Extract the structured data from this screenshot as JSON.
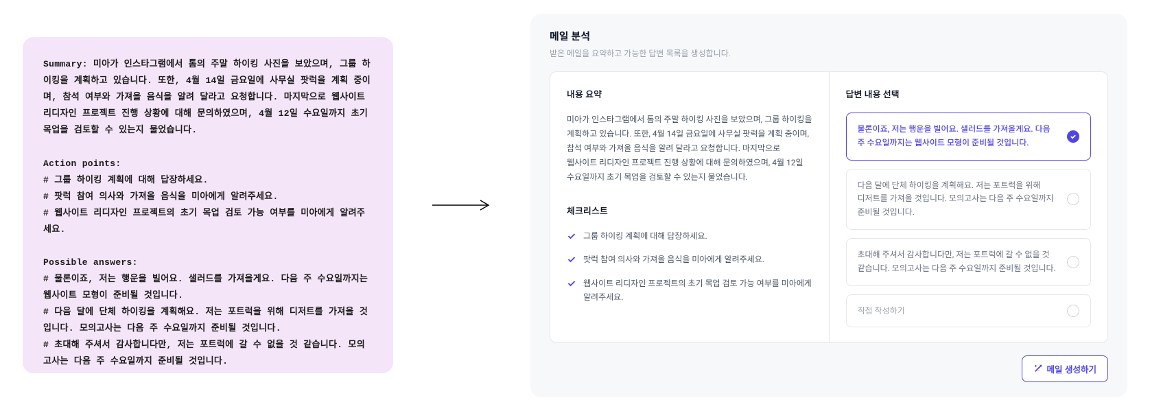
{
  "left": {
    "summary_label": "Summary:",
    "summary_text": " 미아가 인스타그램에서 톰의 주말 하이킹 사진을 보았으며, 그룹 하이킹을 계획하고 있습니다. 또한, 4월 14일 금요일에 사무실 팟럭을 계획 중이며, 참석 여부와 가져올 음식을 알려 달라고 요청합니다. 마지막으로 웹사이트 리디자인 프로젝트 진행 상황에 대해 문의하였으며, 4월 12일 수요일까지 초기 목업을 검토할 수 있는지 물었습니다.",
    "action_label": "Action points:",
    "action_items": [
      "# 그룹 하이킹 계획에 대해 답장하세요.",
      "# 팟럭 참여 의사와 가져올 음식을 미아에게 알려주세요.",
      "# 웹사이트 리디자인 프로젝트의 초기 목업 검토 가능 여부를 미아에게 알려주세요."
    ],
    "answers_label": "Possible answers:",
    "answers": [
      "# 물론이죠, 저는 행운을 빌어요. 샐러드를 가져올게요. 다음 주 수요일까지는 웹사이트 모형이 준비될 것입니다.",
      "# 다음 달에 단체 하이킹을 계획해요. 저는 포트럭을 위해 디저트를 가져올 것입니다. 모의고사는 다음 주 수요일까지 준비될 것입니다.",
      "# 초대해 주셔서 감사합니다만, 저는 포트럭에 갈 수 없을 것 같습니다. 모의고사는 다음 주 수요일까지 준비될 것입니다."
    ]
  },
  "right": {
    "title": "메일 분석",
    "subtitle": "받은 메일을 요약하고 가능한 답변 목록을 생성합니다.",
    "summary_section": "내용 요약",
    "summary_body": "미아가 인스타그램에서 톰의 주말 하이킹 사진을 보았으며, 그룹 하이킹을 계획하고 있습니다. 또한, 4월 14일 금요일에 사무실 팟럭을 계획 중이며, 참석 여부와 가져올 음식을 알려 달라고 요청합니다. 마지막으로 웹사이트 리디자인 프로젝트 진행 상황에 대해 문의하였으며, 4월 12일 수요일까지 초기 목업을 검토할 수 있는지 물었습니다.",
    "checklist_section": "체크리스트",
    "checklist": [
      "그룹 하이킹 계획에 대해 답장하세요.",
      "팟럭 참여 의사와 가져올 음식을 미아에게 알려주세요.",
      "웹사이트 리디자인 프로젝트의 초기 목업 검토 가능 여부를 미아에게 알려주세요."
    ],
    "answers_section": "답변 내용 선택",
    "answers": [
      "물론이죠, 저는 행운을 빌어요. 샐러드를 가져올게요. 다음 주 수요일까지는 웹사이트 모형이 준비될 것입니다.",
      "다음 달에 단체 하이킹을 계획해요. 저는 포트럭을 위해 디저트를 가져올 것입니다. 모의고사는 다음 주 수요일까지 준비될 것입니다.",
      "초대해 주셔서 감사합니다만, 저는 포트럭에 갈 수 없을 것 같습니다. 모의고사는 다음 주 수요일까지 준비될 것입니다."
    ],
    "custom_label": "직접 작성하기",
    "generate_btn": "메일 생성하기"
  }
}
